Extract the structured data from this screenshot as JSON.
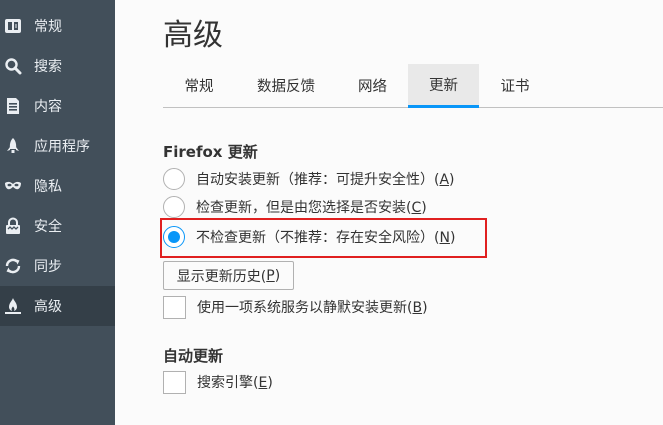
{
  "sidebar": {
    "items": [
      {
        "label": "常规",
        "icon": "general-icon"
      },
      {
        "label": "搜索",
        "icon": "search-icon"
      },
      {
        "label": "内容",
        "icon": "content-icon"
      },
      {
        "label": "应用程序",
        "icon": "applications-icon"
      },
      {
        "label": "隐私",
        "icon": "privacy-mask-icon"
      },
      {
        "label": "安全",
        "icon": "security-icon"
      },
      {
        "label": "同步",
        "icon": "sync-icon"
      },
      {
        "label": "高级",
        "icon": "advanced-icon"
      }
    ],
    "active": "高级"
  },
  "page": {
    "title": "高级"
  },
  "tabs": [
    {
      "label": "常规"
    },
    {
      "label": "数据反馈"
    },
    {
      "label": "网络"
    },
    {
      "label": "更新"
    },
    {
      "label": "证书"
    }
  ],
  "active_tab": "更新",
  "updates": {
    "section_title": "Firefox 更新",
    "options": [
      {
        "text": "自动安装更新（推荐：可提升安全性）(",
        "key": "A",
        "tail": ")",
        "checked": false
      },
      {
        "text": "检查更新，但是由您选择是否安装(",
        "key": "C",
        "tail": ")",
        "checked": false
      },
      {
        "text": "不检查更新（不推荐：存在安全风险）(",
        "key": "N",
        "tail": ")",
        "checked": true
      }
    ],
    "history_button": {
      "text": "显示更新历史(",
      "key": "P",
      "tail": ")"
    },
    "background_service": {
      "text": "使用一项系统服务以静默安装更新(",
      "key": "B",
      "tail": ")",
      "checked": false
    }
  },
  "auto_update": {
    "section_title": "自动更新",
    "search_engines": {
      "text": "搜索引擎(",
      "key": "E",
      "tail": ")",
      "checked": false
    }
  },
  "colors": {
    "sidebar_bg": "#424f5a",
    "sidebar_active_bg": "#343f48",
    "accent": "#0996f8",
    "highlight_border": "#e02020"
  }
}
